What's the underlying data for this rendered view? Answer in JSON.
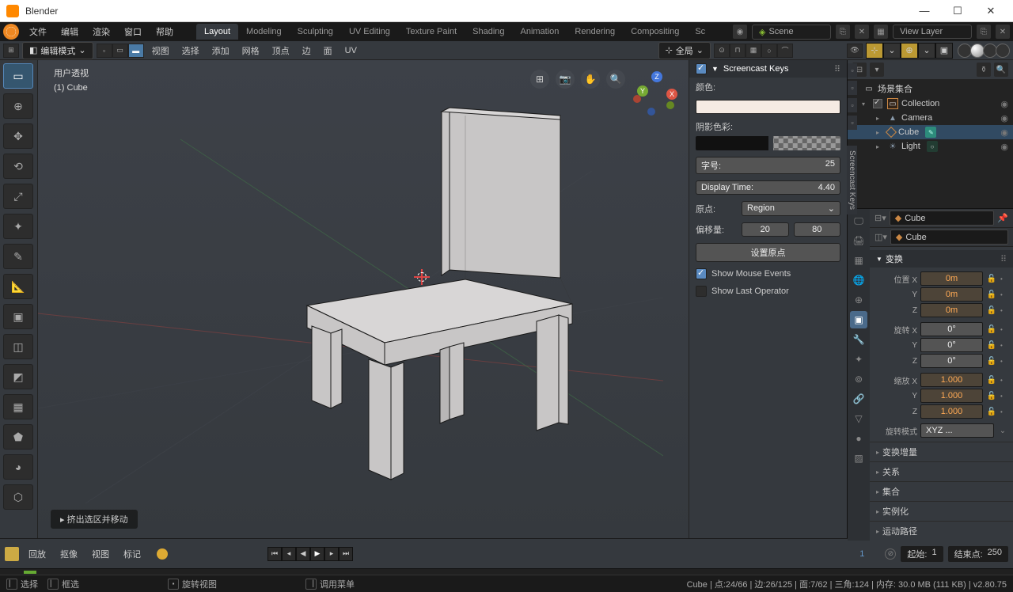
{
  "app": {
    "title": "Blender"
  },
  "menu": {
    "items": [
      "文件",
      "编辑",
      "渲染",
      "窗口",
      "帮助"
    ]
  },
  "workspaces": {
    "active": "Layout",
    "tabs": [
      "Layout",
      "Modeling",
      "Sculpting",
      "UV Editing",
      "Texture Paint",
      "Shading",
      "Animation",
      "Rendering",
      "Compositing",
      "Sc"
    ]
  },
  "scene": {
    "label": "Scene",
    "layer": "View Layer"
  },
  "header": {
    "mode": "编辑模式",
    "menus": [
      "视图",
      "选择",
      "添加",
      "网格",
      "顶点",
      "边",
      "面",
      "UV"
    ],
    "orientation": "全局"
  },
  "viewport": {
    "label1": "用户透视",
    "label2": "(1) Cube",
    "operator": "挤出选区并移动"
  },
  "npanel": {
    "title": "Screencast Keys",
    "color": "颜色:",
    "shadow": "阴影色彩:",
    "fontsize_lbl": "字号:",
    "fontsize_val": "25",
    "display_lbl": "Display Time:",
    "display_val": "4.40",
    "origin_lbl": "原点:",
    "origin_val": "Region",
    "offset_lbl": "偏移量:",
    "offset_x": "20",
    "offset_y": "80",
    "setorigin": "设置原点",
    "mouse": "Show Mouse Events",
    "lastop": "Show Last Operator",
    "sidetab": "Screencast Keys"
  },
  "outliner": {
    "root": "场景集合",
    "collection": "Collection",
    "items": [
      {
        "name": "Camera",
        "icon": "cam"
      },
      {
        "name": "Cube",
        "icon": "mesh",
        "selected": true
      },
      {
        "name": "Light",
        "icon": "light"
      }
    ]
  },
  "properties": {
    "bread1": "Cube",
    "bread2": "Cube",
    "transform_head": "变换",
    "location_lbl": "位置 X",
    "rotation_lbl": "旋转 X",
    "scale_lbl": "缩放 X",
    "loc": [
      "0m",
      "0m",
      "0m"
    ],
    "rot": [
      "0°",
      "0°",
      "0°"
    ],
    "scale": [
      "1.000",
      "1.000",
      "1.000"
    ],
    "rotmode_lbl": "旋转模式",
    "rotmode_val": "XYZ ...",
    "sections": [
      "变换增量",
      "关系",
      "集合",
      "实例化",
      "运动路径"
    ]
  },
  "timeline": {
    "items": [
      "回放",
      "抠像",
      "视图",
      "标记"
    ],
    "frame": "1",
    "start_lbl": "起始:",
    "start": "1",
    "end_lbl": "结束点:",
    "end": "250"
  },
  "status": {
    "select": "选择",
    "box": "框选",
    "rotate": "旋转视图",
    "callmenu": "调用菜单",
    "right": "Cube | 点:24/66 | 边:26/125 | 面:7/62 | 三角:124 | 内存: 30.0 MB (111 KB) | v2.80.75"
  }
}
